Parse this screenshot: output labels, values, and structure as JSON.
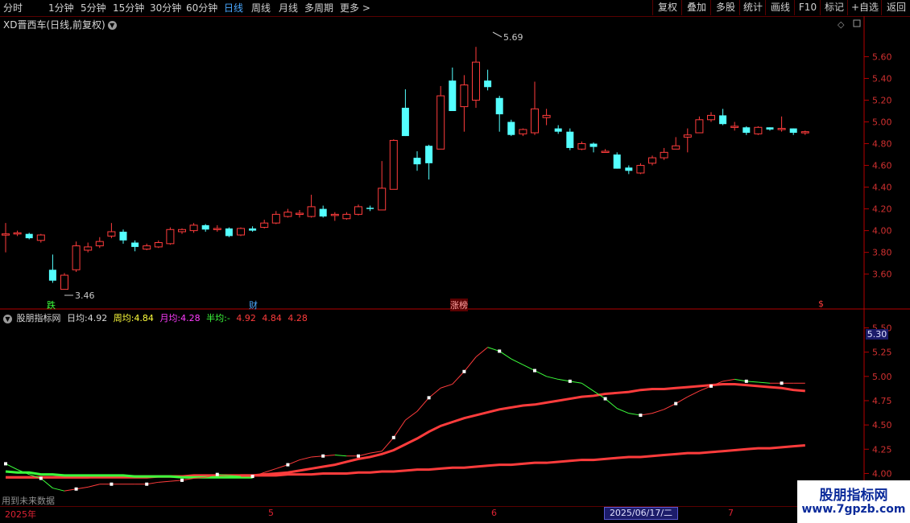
{
  "toolbar": {
    "periods": [
      "分时",
      "1分钟",
      "5分钟",
      "15分钟",
      "30分钟",
      "60分钟",
      "日线",
      "周线",
      "月线",
      "多周期",
      "更多 >"
    ],
    "active_period": "日线",
    "right_buttons": [
      "复权",
      "叠加",
      "多股",
      "统计",
      "画线",
      "F10",
      "标记",
      "+自选",
      "返回"
    ]
  },
  "chart_title": "XD晋西车(日线,前复权)",
  "price_axis": [
    "5.60",
    "5.40",
    "5.20",
    "5.00",
    "4.80",
    "4.60",
    "4.40",
    "4.20",
    "4.00",
    "3.80",
    "3.60"
  ],
  "annotations": {
    "high": "5.69",
    "low": "3.46"
  },
  "markers": {
    "fall": "跌",
    "finance": "财",
    "limit": "涨榜",
    "s": "$"
  },
  "indicator": {
    "name": "股朋指标网",
    "day_label": "日均:",
    "day_value": "4.92",
    "week_label": "周均:",
    "week_value": "4.84",
    "month_label": "月均:",
    "month_value": "4.28",
    "half_label": "半均:",
    "half_value": "-",
    "extra": [
      "4.92",
      "4.84",
      "4.28"
    ]
  },
  "indicator_axis": [
    "5.50",
    "5.25",
    "5.00",
    "4.75",
    "4.50",
    "4.25",
    "4.00"
  ],
  "indicator_current": "5.30",
  "x_axis": {
    "year": "2025年",
    "m5": "5",
    "m6": "6",
    "m7": "7",
    "cursor_date": "2025/06/17/二"
  },
  "footer_note": "用到未来数据",
  "watermark": {
    "title": "股朋指标网",
    "url": "www.7gpzb.com"
  },
  "colors": {
    "up": "#ff3c3c",
    "down": "#54ffff",
    "green": "#3cff3c",
    "axis": "#b40000"
  },
  "chart_data": {
    "type": "candlestick",
    "candles": [
      [
        3.96,
        3.97,
        4.07,
        3.8
      ],
      [
        3.97,
        3.98,
        4.0,
        3.95
      ],
      [
        3.97,
        3.93,
        3.98,
        3.92
      ],
      [
        3.91,
        3.96,
        3.97,
        3.89
      ],
      [
        3.64,
        3.54,
        3.78,
        3.52
      ],
      [
        3.46,
        3.59,
        3.61,
        3.46
      ],
      [
        3.64,
        3.86,
        3.9,
        3.62
      ],
      [
        3.82,
        3.85,
        3.89,
        3.8
      ],
      [
        3.86,
        3.9,
        3.94,
        3.84
      ],
      [
        3.95,
        3.99,
        4.07,
        3.93
      ],
      [
        3.99,
        3.91,
        4.01,
        3.88
      ],
      [
        3.89,
        3.85,
        3.91,
        3.81
      ],
      [
        3.83,
        3.86,
        3.88,
        3.82
      ],
      [
        3.85,
        3.89,
        3.91,
        3.84
      ],
      [
        3.88,
        4.01,
        4.03,
        3.87
      ],
      [
        3.99,
        4.01,
        4.02,
        3.97
      ],
      [
        4.0,
        4.05,
        4.07,
        3.98
      ],
      [
        4.05,
        4.01,
        4.06,
        3.99
      ],
      [
        4.02,
        4.02,
        4.05,
        3.99
      ],
      [
        4.02,
        3.95,
        4.03,
        3.94
      ],
      [
        3.96,
        4.02,
        4.03,
        3.95
      ],
      [
        4.02,
        4.0,
        4.04,
        3.99
      ],
      [
        4.03,
        4.07,
        4.1,
        4.02
      ],
      [
        4.07,
        4.15,
        4.18,
        4.06
      ],
      [
        4.13,
        4.17,
        4.2,
        4.12
      ],
      [
        4.16,
        4.16,
        4.19,
        4.12
      ],
      [
        4.13,
        4.22,
        4.33,
        4.12
      ],
      [
        4.2,
        4.13,
        4.23,
        4.12
      ],
      [
        4.15,
        4.15,
        4.17,
        4.09
      ],
      [
        4.11,
        4.15,
        4.17,
        4.1
      ],
      [
        4.15,
        4.22,
        4.24,
        4.14
      ],
      [
        4.21,
        4.2,
        4.23,
        4.18
      ],
      [
        4.19,
        4.39,
        4.64,
        4.19
      ],
      [
        4.38,
        4.83,
        4.84,
        4.38
      ],
      [
        5.13,
        4.87,
        5.3,
        4.87
      ],
      [
        4.67,
        4.61,
        4.73,
        4.55
      ],
      [
        4.78,
        4.62,
        4.79,
        4.47
      ],
      [
        4.75,
        5.24,
        5.33,
        4.75
      ],
      [
        5.38,
        5.1,
        5.5,
        5.1
      ],
      [
        5.14,
        5.34,
        5.43,
        4.91
      ],
      [
        5.2,
        5.55,
        5.69,
        5.13
      ],
      [
        5.38,
        5.32,
        5.48,
        5.29
      ],
      [
        5.22,
        5.07,
        5.24,
        4.91
      ],
      [
        5.0,
        4.88,
        5.02,
        4.87
      ],
      [
        4.89,
        4.93,
        4.94,
        4.87
      ],
      [
        4.9,
        5.12,
        5.37,
        4.88
      ],
      [
        5.04,
        5.06,
        5.12,
        4.97
      ],
      [
        4.94,
        4.91,
        4.97,
        4.89
      ],
      [
        4.91,
        4.76,
        4.94,
        4.74
      ],
      [
        4.75,
        4.8,
        4.82,
        4.74
      ],
      [
        4.8,
        4.77,
        4.81,
        4.72
      ],
      [
        4.73,
        4.73,
        4.75,
        4.72
      ],
      [
        4.7,
        4.57,
        4.72,
        4.57
      ],
      [
        4.58,
        4.55,
        4.6,
        4.52
      ],
      [
        4.53,
        4.6,
        4.62,
        4.52
      ],
      [
        4.62,
        4.67,
        4.69,
        4.6
      ],
      [
        4.67,
        4.72,
        4.76,
        4.65
      ],
      [
        4.75,
        4.78,
        4.86,
        4.75
      ],
      [
        4.86,
        4.88,
        4.94,
        4.72
      ],
      [
        4.9,
        5.02,
        5.05,
        4.9
      ],
      [
        5.02,
        5.06,
        5.09,
        5.0
      ],
      [
        5.06,
        4.98,
        5.12,
        4.97
      ],
      [
        4.96,
        4.96,
        5.0,
        4.92
      ],
      [
        4.95,
        4.9,
        4.96,
        4.88
      ],
      [
        4.89,
        4.95,
        4.96,
        4.88
      ],
      [
        4.95,
        4.93,
        4.95,
        4.92
      ],
      [
        4.94,
        4.94,
        5.05,
        4.91
      ],
      [
        4.94,
        4.9,
        4.94,
        4.88
      ],
      [
        4.91,
        4.91,
        4.92,
        4.88
      ]
    ],
    "candle_format": [
      "open",
      "close",
      "high",
      "low"
    ],
    "price_range": [
      3.42,
      5.84
    ],
    "indicator_series": {
      "day": [
        4.1,
        4.04,
        3.99,
        3.95,
        3.85,
        3.82,
        3.84,
        3.86,
        3.89,
        3.89,
        3.89,
        3.89,
        3.89,
        3.91,
        3.92,
        3.93,
        3.95,
        3.96,
        3.99,
        3.98,
        3.97,
        3.97,
        4.01,
        4.05,
        4.09,
        4.14,
        4.17,
        4.18,
        4.19,
        4.18,
        4.18,
        4.21,
        4.23,
        4.37,
        4.55,
        4.64,
        4.78,
        4.88,
        4.92,
        5.05,
        5.2,
        5.3,
        5.26,
        5.18,
        5.12,
        5.06,
        5.0,
        4.97,
        4.95,
        4.93,
        4.85,
        4.77,
        4.67,
        4.62,
        4.6,
        4.62,
        4.66,
        4.72,
        4.79,
        4.85,
        4.9,
        4.95,
        4.97,
        4.95,
        4.94,
        4.93,
        4.93,
        4.93,
        4.93
      ],
      "week": [
        3.96,
        3.96,
        3.96,
        3.96,
        3.96,
        3.96,
        3.96,
        3.96,
        3.97,
        3.97,
        3.97,
        3.97,
        3.97,
        3.97,
        3.97,
        3.97,
        3.98,
        3.98,
        3.98,
        3.98,
        3.98,
        3.98,
        3.99,
        4.0,
        4.01,
        4.03,
        4.05,
        4.07,
        4.09,
        4.12,
        4.15,
        4.17,
        4.2,
        4.24,
        4.3,
        4.36,
        4.43,
        4.49,
        4.53,
        4.57,
        4.6,
        4.63,
        4.66,
        4.68,
        4.7,
        4.71,
        4.73,
        4.75,
        4.77,
        4.79,
        4.8,
        4.82,
        4.83,
        4.84,
        4.86,
        4.87,
        4.87,
        4.88,
        4.89,
        4.9,
        4.91,
        4.92,
        4.92,
        4.91,
        4.9,
        4.89,
        4.88,
        4.86,
        4.85
      ],
      "month": [
        3.96,
        3.96,
        3.96,
        3.96,
        3.96,
        3.96,
        3.96,
        3.96,
        3.96,
        3.96,
        3.96,
        3.96,
        3.96,
        3.97,
        3.97,
        3.97,
        3.97,
        3.97,
        3.97,
        3.97,
        3.98,
        3.98,
        3.98,
        3.98,
        3.99,
        3.99,
        3.99,
        4.0,
        4.0,
        4.0,
        4.01,
        4.01,
        4.02,
        4.02,
        4.03,
        4.04,
        4.04,
        4.05,
        4.06,
        4.06,
        4.07,
        4.08,
        4.09,
        4.09,
        4.1,
        4.11,
        4.11,
        4.12,
        4.13,
        4.14,
        4.14,
        4.15,
        4.16,
        4.17,
        4.17,
        4.18,
        4.19,
        4.2,
        4.21,
        4.21,
        4.22,
        4.23,
        4.24,
        4.25,
        4.26,
        4.26,
        4.27,
        4.28,
        4.29
      ],
      "green_base": [
        4.02,
        4.01,
        4.01,
        3.99,
        3.99,
        3.98,
        3.98,
        3.98,
        3.98,
        3.98,
        3.98,
        3.97,
        3.97,
        3.97,
        3.97,
        3.96,
        3.96,
        3.96,
        3.96,
        3.96,
        3.96,
        3.96
      ]
    },
    "indicator_range": [
      3.78,
      5.62
    ]
  }
}
